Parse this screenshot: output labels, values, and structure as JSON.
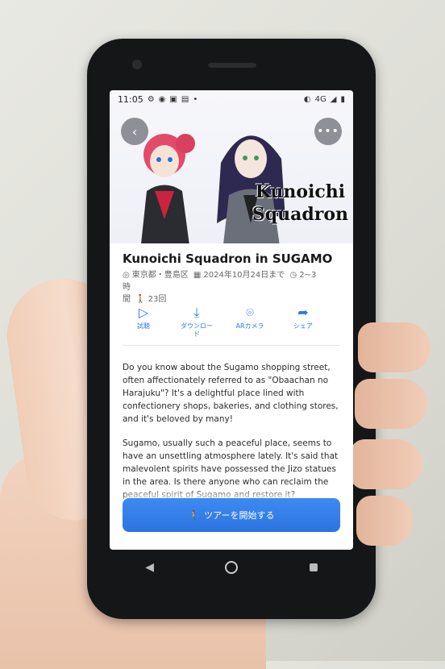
{
  "status_bar": {
    "time": "11:05",
    "signal": "4G"
  },
  "tour": {
    "title": "Kunoichi Squadron in SUGAMO",
    "hero_title": "Kunoichi Squadron",
    "location": "東京都・豊島区",
    "until": "2024年10月24日まで",
    "duration_a": "2~3時",
    "duration_b": "間",
    "plays": "23回"
  },
  "actions": [
    {
      "label": "試聴",
      "icon": "play-icon"
    },
    {
      "label": "ダウンロード",
      "icon": "download-icon"
    },
    {
      "label": "ARカメラ",
      "icon": "camera-icon"
    },
    {
      "label": "シェア",
      "icon": "share-icon"
    }
  ],
  "description": {
    "p1": "Do you know about the Sugamo shopping street, often affectionately referred to as \"Obaachan no Harajuku\"? It's a delightful place lined with confectionery shops, bakeries, and clothing stores, and it's beloved by many!",
    "p2": "Sugamo, usually such a peaceful place, seems to have an unsettling atmosphere lately. It's said that malevolent spirits have possessed the Jizo statues in the area. Is there anyone who can reclaim the peaceful spirit of Sugamo and restore it?"
  },
  "start_button": "ツアーを開始する",
  "colors": {
    "accent": "#2d79e3",
    "button": "#3383ea"
  }
}
